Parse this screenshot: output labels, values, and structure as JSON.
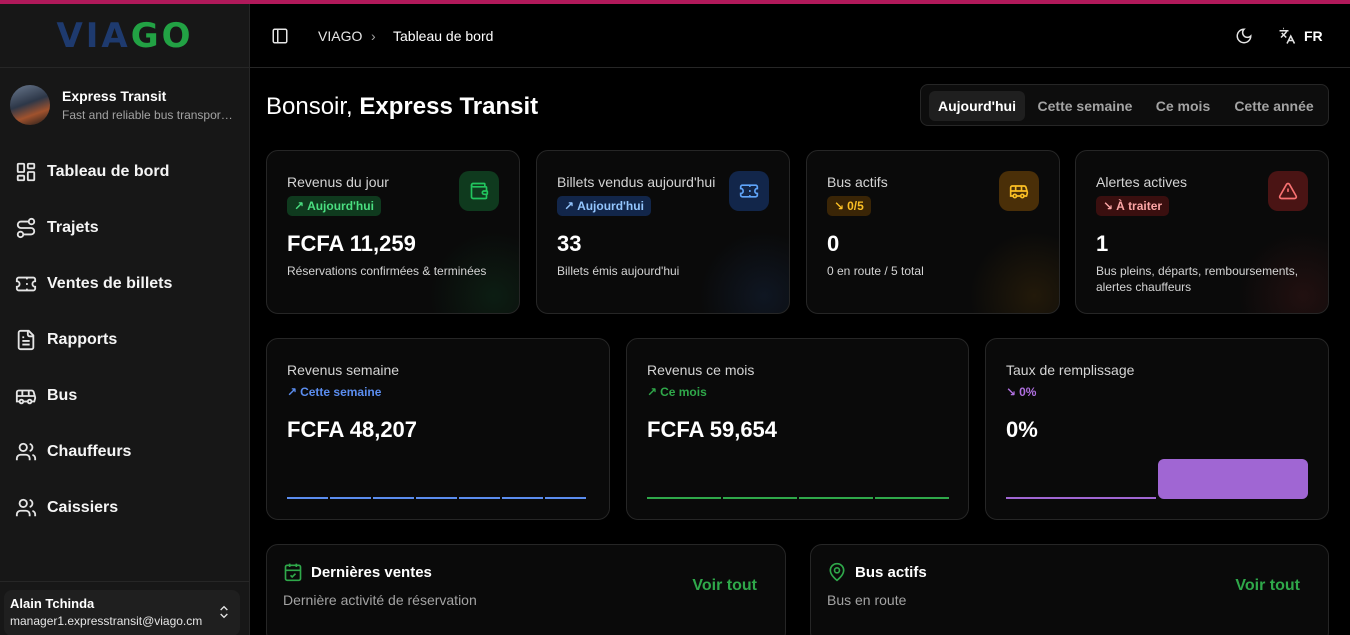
{
  "brand": {
    "part1": "VIA",
    "part2": "GO"
  },
  "company": {
    "name": "Express Transit",
    "description": "Fast and reliable bus transport..."
  },
  "nav": [
    {
      "label": "Tableau de bord",
      "icon": "dashboard-icon"
    },
    {
      "label": "Trajets",
      "icon": "route-icon"
    },
    {
      "label": "Ventes de billets",
      "icon": "ticket-icon"
    },
    {
      "label": "Rapports",
      "icon": "report-icon"
    },
    {
      "label": "Bus",
      "icon": "bus-icon"
    },
    {
      "label": "Chauffeurs",
      "icon": "users-icon"
    },
    {
      "label": "Caissiers",
      "icon": "users-icon"
    }
  ],
  "user": {
    "name": "Alain Tchinda",
    "email": "manager1.expresstransit@viago.cm"
  },
  "header": {
    "breadcrumb_root": "VIAGO",
    "breadcrumb_sep": "›",
    "breadcrumb_current": "Tableau de bord",
    "language": "FR"
  },
  "greeting": {
    "prefix": "Bonsoir,",
    "name": "Express Transit"
  },
  "periods": {
    "today": "Aujourd'hui",
    "week": "Cette semaine",
    "month": "Ce mois",
    "year": "Cette année",
    "selected": "Aujourd'hui"
  },
  "stats": [
    {
      "title": "Revenus du jour",
      "badge": "Aujourd'hui",
      "value": "FCFA 11,259",
      "sub": "Réservations confirmées & terminées",
      "accent": "#22c55e"
    },
    {
      "title": "Billets vendus aujourd'hui",
      "badge": "Aujourd'hui",
      "value": "33",
      "sub": "Billets émis aujourd'hui",
      "accent": "#3b82f6"
    },
    {
      "title": "Bus actifs",
      "badge": "0/5",
      "value": "0",
      "sub": "0 en route / 5 total",
      "accent": "#f59e0b"
    },
    {
      "title": "Alertes actives",
      "badge": "À traiter",
      "value": "1",
      "sub": "Bus pleins, départs, remboursements, alertes chauffeurs",
      "accent": "#ef4444"
    }
  ],
  "mid": [
    {
      "title": "Revenus semaine",
      "trend": "Cette semaine",
      "value": "FCFA 48,207",
      "color": "#5b8def"
    },
    {
      "title": "Revenus ce mois",
      "trend": "Ce mois",
      "value": "FCFA 59,654",
      "color": "#2fa84a"
    },
    {
      "title": "Taux de remplissage",
      "trend": "0%",
      "value": "0%",
      "color": "#a066d3"
    }
  ],
  "bottom": [
    {
      "title": "Dernières ventes",
      "subtitle": "Dernière activité de réservation",
      "link": "Voir tout",
      "icon": "calendar-check-icon"
    },
    {
      "title": "Bus actifs",
      "subtitle": "Bus en route",
      "link": "Voir tout",
      "icon": "map-pin-icon"
    }
  ]
}
